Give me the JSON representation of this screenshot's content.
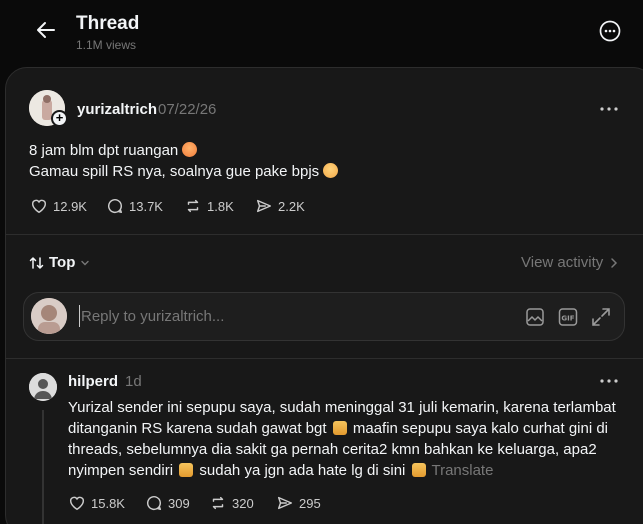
{
  "header": {
    "title": "Thread",
    "views": "1.1M views"
  },
  "post": {
    "author": "yurizaltrich",
    "time": "07/22/26",
    "lines": [
      "8 jam blm dpt ruangan",
      "Gamau spill RS nya, soalnya gue pake bpjs"
    ],
    "likes": "12.9K",
    "comments": "13.7K",
    "reposts": "1.8K",
    "shares": "2.2K"
  },
  "sort": {
    "label": "Top",
    "view_activity": "View activity"
  },
  "reply": {
    "placeholder": "Reply to yurizaltrich..."
  },
  "comment": {
    "author": "hilperd",
    "time": "1d",
    "lines": [
      "Yurizal sender ini sepupu saya, sudah meninggal 31 juli kemarin, karena terlambat",
      "ditanganin RS karena sudah gawat bgt",
      "maafin sepupu saya kalo curhat gini di",
      "threads, sebelumnya dia sakit ga pernah cerita2 kmn bahkan ke keluarga, apa2",
      "nyimpen sendiri",
      "sudah ya jgn ada hate lg di sini"
    ],
    "translate": "Translate",
    "likes": "15.8K",
    "comments": "309",
    "reposts": "320",
    "shares": "295"
  }
}
